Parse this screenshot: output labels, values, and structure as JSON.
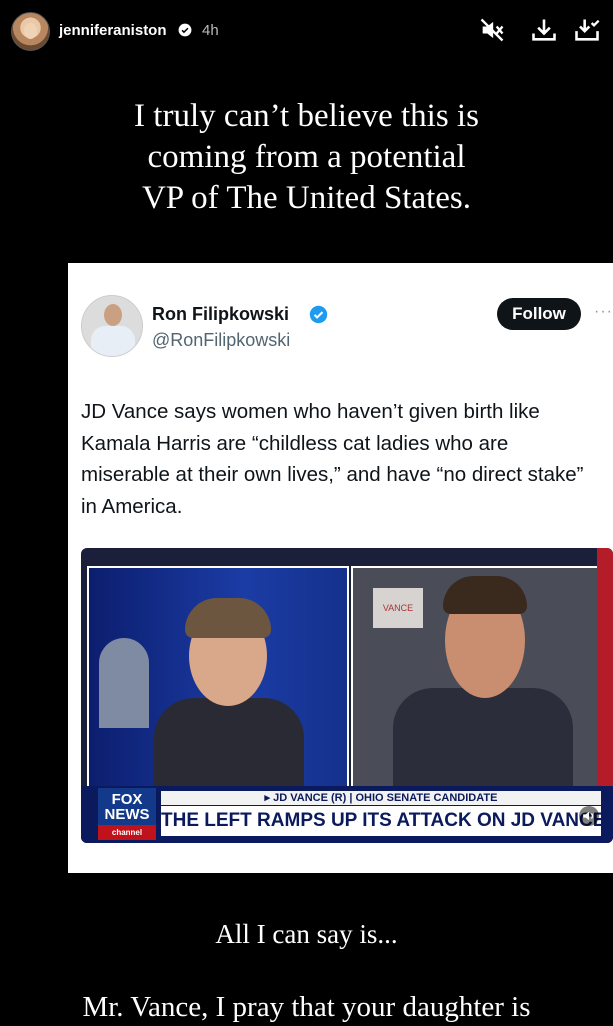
{
  "story": {
    "username": "jenniferaniston",
    "time_ago": "4h",
    "icons": [
      "mute-icon",
      "download-icon",
      "save-icon"
    ]
  },
  "captions": {
    "line1": "I truly can’t believe this is",
    "line2": "coming from a potential",
    "line3": "VP of The United States.",
    "bottom1": "All I can say is...",
    "bottom2": "Mr. Vance, I pray that your daughter is"
  },
  "tweet": {
    "name": "Ron Filipkowski",
    "handle": "@RonFilipkowski",
    "follow_label": "Follow",
    "more": "···",
    "text": "JD Vance says women who haven’t given birth like Kamala Harris are “childless cat ladies who are miserable at their own lives,” and have “no direct stake” in America."
  },
  "video": {
    "logo_line1": "FOX",
    "logo_line2": "NEWS",
    "logo_channel": "channel",
    "lower_third_top": "▸ JD VANCE (R) | OHIO SENATE CANDIDATE",
    "lower_third_main": "THE LEFT RAMPS UP ITS ATTACK ON JD VANCE",
    "sign_text": "VANCE"
  },
  "colors": {
    "verified_blue": "#1d9bf0",
    "fox_red": "#c0121b",
    "fox_blue": "#0b1a5c"
  }
}
